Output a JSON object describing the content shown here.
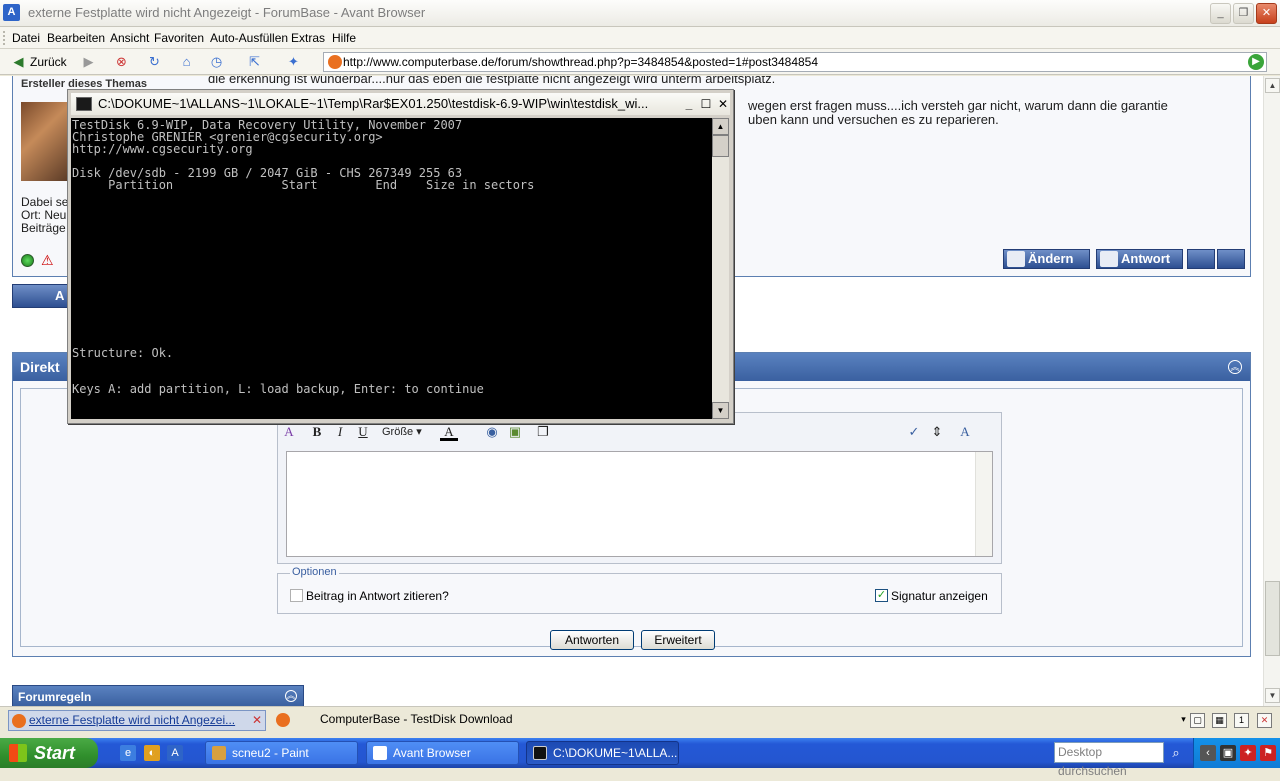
{
  "window": {
    "title": "externe Festplatte wird nicht Angezeigt - ForumBase - Avant Browser",
    "app_icon": "A",
    "minimize": "_",
    "maximize": "❐",
    "close": "✕"
  },
  "menu": [
    "Datei",
    "Bearbeiten",
    "Ansicht",
    "Favoriten",
    "Auto-Ausfüllen",
    "Extras",
    "Hilfe"
  ],
  "toolbar": {
    "back_label": "Zurück",
    "address": "http://www.computerbase.de/forum/showthread.php?p=3484854&posted=1#post3484854"
  },
  "post": {
    "author_label": "Ersteller dieses Themas",
    "body_line1": "die erkennung ist wunderbar....nur das eben die festplatte nicht angezeigt wird unterm arbeitsplatz.",
    "body_line2": "wegen erst fragen muss....ich versteh gar nicht, warum dann die garantie",
    "body_line3": "uben kann und versuchen es zu reparieren.",
    "info_line1": "Dabei se",
    "info_line2": "Ort: Neu",
    "info_line3": "Beiträge",
    "edit_button": "Ändern",
    "reply_button": "Antwort",
    "reply_left_button": "A"
  },
  "nav_link": "»",
  "quick_reply": {
    "header": "Direkt",
    "size_select": "Größe",
    "options_legend": "Optionen",
    "quote_checkbox_label": "Beitrag in Antwort zitieren?",
    "quote_checked": false,
    "signature_checkbox_label": "Signatur anzeigen",
    "signature_checked": true,
    "submit_button": "Antworten",
    "advanced_button": "Erweitert"
  },
  "rules_box": {
    "label": "Forumregeln"
  },
  "tabs": [
    {
      "label": "externe Festplatte wird nicht Angezei...",
      "active": true
    },
    {
      "label": "ComputerBase - TestDisk Download",
      "active": false
    }
  ],
  "taskbar": {
    "start_label": "Start",
    "tasks": [
      {
        "label": "scneu2 - Paint",
        "active": false
      },
      {
        "label": "Avant Browser",
        "active": false
      },
      {
        "label": "C:\\DOKUME~1\\ALLA...",
        "active": true
      }
    ],
    "search_placeholder": "Desktop durchsuchen"
  },
  "console": {
    "title": "C:\\DOKUME~1\\ALLANS~1\\LOKALE~1\\Temp\\Rar$EX01.250\\testdisk-6.9-WIP\\win\\testdisk_wi...",
    "lines": [
      "TestDisk 6.9-WIP, Data Recovery Utility, November 2007",
      "Christophe GRENIER <grenier@cgsecurity.org>",
      "http://www.cgsecurity.org",
      "",
      "Disk /dev/sdb - 2199 GB / 2047 GiB - CHS 267349 255 63",
      "     Partition               Start        End    Size in sectors",
      "Structure: Ok.",
      "Keys A: add partition, L: load backup, Enter: to continue"
    ]
  },
  "colors": {
    "accent_blue": "#3a60a0",
    "console_bg": "#000000",
    "console_text": "#c0c0c0",
    "taskbar_blue": "#2458d6",
    "start_green": "#308f2c"
  }
}
